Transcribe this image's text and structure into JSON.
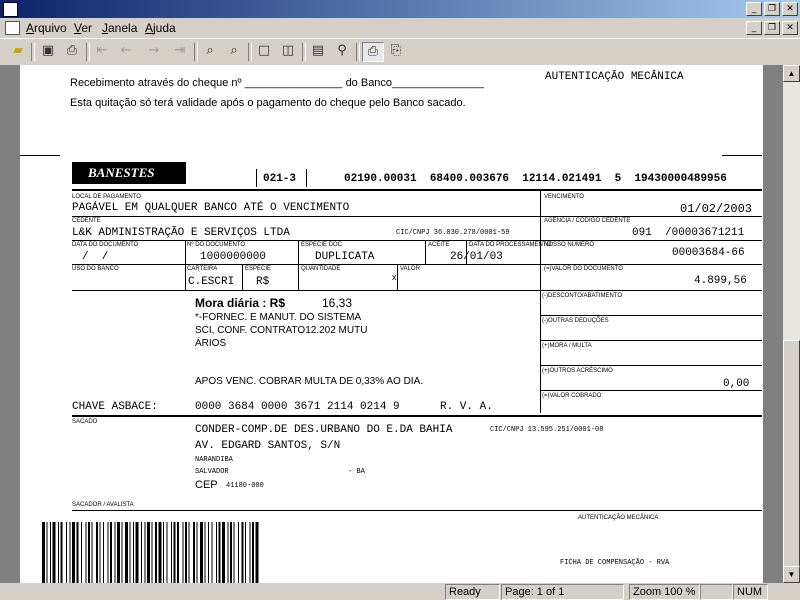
{
  "window": {
    "app_icon": "document-icon",
    "app_controls": [
      "_",
      "❐",
      "✕"
    ],
    "doc_controls": [
      "_",
      "❐",
      "✕"
    ]
  },
  "menu": {
    "items": [
      {
        "first": "A",
        "rest": "rquivo"
      },
      {
        "first": "V",
        "rest": "er"
      },
      {
        "first": "J",
        "rest": "anela"
      },
      {
        "first": "A",
        "rest": "juda"
      }
    ]
  },
  "toolbar": {
    "icons": [
      "open-folder-icon",
      "save-icon",
      "print-icon",
      "first-page-icon",
      "prev-page-icon",
      "next-page-icon",
      "last-page-icon",
      "zoom-in-icon",
      "zoom-out-icon",
      "one-page-icon",
      "two-page-icon",
      "page-setup-icon",
      "find-icon",
      "print-setup-icon",
      "export-icon"
    ]
  },
  "receipt": {
    "line1_a": "Recebimento através do cheque nº ________________ do Banco_______________",
    "line2": "Esta quitação só terá validade após o pagamento do cheque pelo Banco sacado.",
    "auth_title": "AUTENTICAÇÃO MECÂNICA"
  },
  "boleto": {
    "bank_name": "BANESTES",
    "bank_code": "021-3",
    "digitable_line": "02190.00031  68400.003676  12114.021491  5  19430000489956",
    "local_label": "LOCAL DE PAGAMENTO",
    "local_value": "PAGÁVEL EM QUALQUER BANCO ATÉ O VENCIMENTO",
    "due_label": "VENCIMENTO",
    "due_value": "01/02/2003",
    "cedente_label": "CEDENTE",
    "cedente_value": "L&K ADMINISTRAÇÃO E SERVIÇOS LTDA",
    "cedente_cnpj": "CIC/CNPJ 36.030.278/0001-59",
    "agency_label": "AGÊNCIA / CÓDIGO CEDENTE",
    "agency_value": "091  /00003671211",
    "doc_date_label": "DATA DO DOCUMENTO",
    "doc_date_value": "/  /",
    "doc_num_label": "Nº DO DOCUMENTO",
    "doc_num_value": "1000000000",
    "species_doc_label": "ESPÉCIE DOC",
    "species_doc_value": "DUPLICATA",
    "accept_label": "ACEITE",
    "proc_date_label": "DATA DO PROCESSAMENTO",
    "proc_date_value": "26/01/03",
    "our_num_label": "NOSSO NÚMERO",
    "our_num_value": "00003684-66",
    "bank_use_label": "USO DO BANCO",
    "carteira_label": "CARTEIRA",
    "carteira_value": "C.ESCRI",
    "especie_label": "ESPÉCIE",
    "especie_value": "R$",
    "qty_label": "QUANTIDADE",
    "value_label": "VALOR",
    "value_mark": "x",
    "doc_value_label": "(=)VALOR DO DOCUMENTO",
    "doc_value_value": "4.899,56",
    "discount_label": "(-)DESCONTO/ABATIMENTO",
    "other_ded_label": "(-)OUTRAS DEDUÇÕES",
    "interest_label": "(+)MORA / MULTA",
    "other_add_label": "(+)OUTROS ACRÉSCIMO",
    "other_add_value": "0,00",
    "charged_label": "(=)VALOR COBRADO",
    "mora_label": "Mora diária : R$",
    "mora_value": "16,33",
    "instr1": "*-FORNEC. E MANUT. DO SISTEMA",
    "instr2": "SCI, CONF. CONTRATO12.202 MUTU",
    "instr3": "ÁRIOS",
    "instr4": "APOS VENC. COBRAR MULTA DE 0,33% AO DIA.",
    "chave_label": "CHAVE ASBACE:",
    "chave_value": "0000 3684 0000 3671 2114 0214 9",
    "rva": "R. V. A.",
    "sacado_label": "SACADO",
    "sacado_name": "CONDER-COMP.DE DES.URBANO DO E.DA BAHIA",
    "sacado_cnpj": "CIC/CNPJ 13.595.251/0001-08",
    "sacado_addr": "AV. EDGARD SANTOS, S/N",
    "sacado_bairro": "NARANDIBA",
    "sacado_city": "SALVADOR",
    "sacado_uf": "- BA",
    "cep_label": "CEP",
    "cep_value": "41180-000",
    "avalista_label": "SACADOR / AVALISTA",
    "auth_footer": "AUTENTICAÇÃO MECÂNICA",
    "ficha": "FICHA DE COMPENSAÇÃO - RVA"
  },
  "status": {
    "ready": "Ready",
    "page": "Page: 1 of 1",
    "zoom": "Zoom 100 %",
    "num": "NUM"
  }
}
